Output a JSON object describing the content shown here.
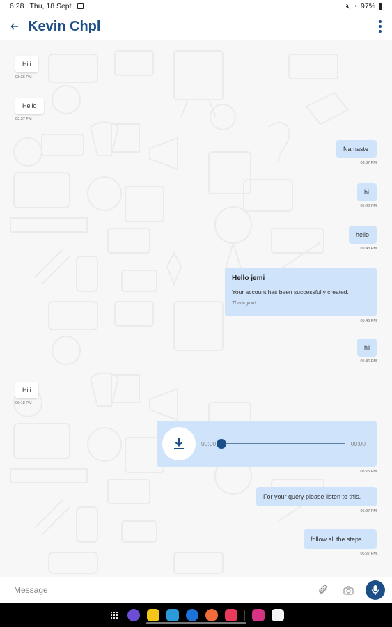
{
  "status": {
    "time": "6:28",
    "date": "Thu, 18 Sept",
    "battery": "97%"
  },
  "header": {
    "title": "Kevin Chpl"
  },
  "messages": [
    {
      "dir": "in",
      "text": "Hiii",
      "time": "03:36 PM"
    },
    {
      "dir": "in",
      "text": "Hello",
      "time": "03:37 PM"
    },
    {
      "dir": "out",
      "text": "Namaste",
      "time": "03:37 PM"
    },
    {
      "dir": "out",
      "text": "hi",
      "time": "05:42 PM"
    },
    {
      "dir": "out",
      "text": "hello",
      "time": "05:43 PM"
    },
    {
      "dir": "out",
      "card": true,
      "title": "Hello jemi",
      "body": "Your account has been successfully created.",
      "footer": "Thank you!",
      "time": "05:46 PM"
    },
    {
      "dir": "out",
      "text": "hii",
      "time": "05:46 PM"
    },
    {
      "dir": "in",
      "text": "Hiii",
      "time": "06:18 PM"
    },
    {
      "dir": "out",
      "audio": true,
      "start": "00:00",
      "end": "00:00",
      "progress": 0,
      "time": "06:25 PM"
    },
    {
      "dir": "out",
      "text": "For your query please listen to this.",
      "time": "06:27 PM"
    },
    {
      "dir": "out",
      "text": "follow all the steps.",
      "time": "06:27 PM"
    }
  ],
  "composer": {
    "placeholder": "Message"
  },
  "colors": {
    "accent": "#1c4f87",
    "outgoing": "#cfe3fb",
    "incoming": "#ffffff"
  },
  "icons": [
    "back-arrow-icon",
    "more-vert-icon",
    "attach-icon",
    "camera-icon",
    "mic-icon",
    "download-icon"
  ]
}
